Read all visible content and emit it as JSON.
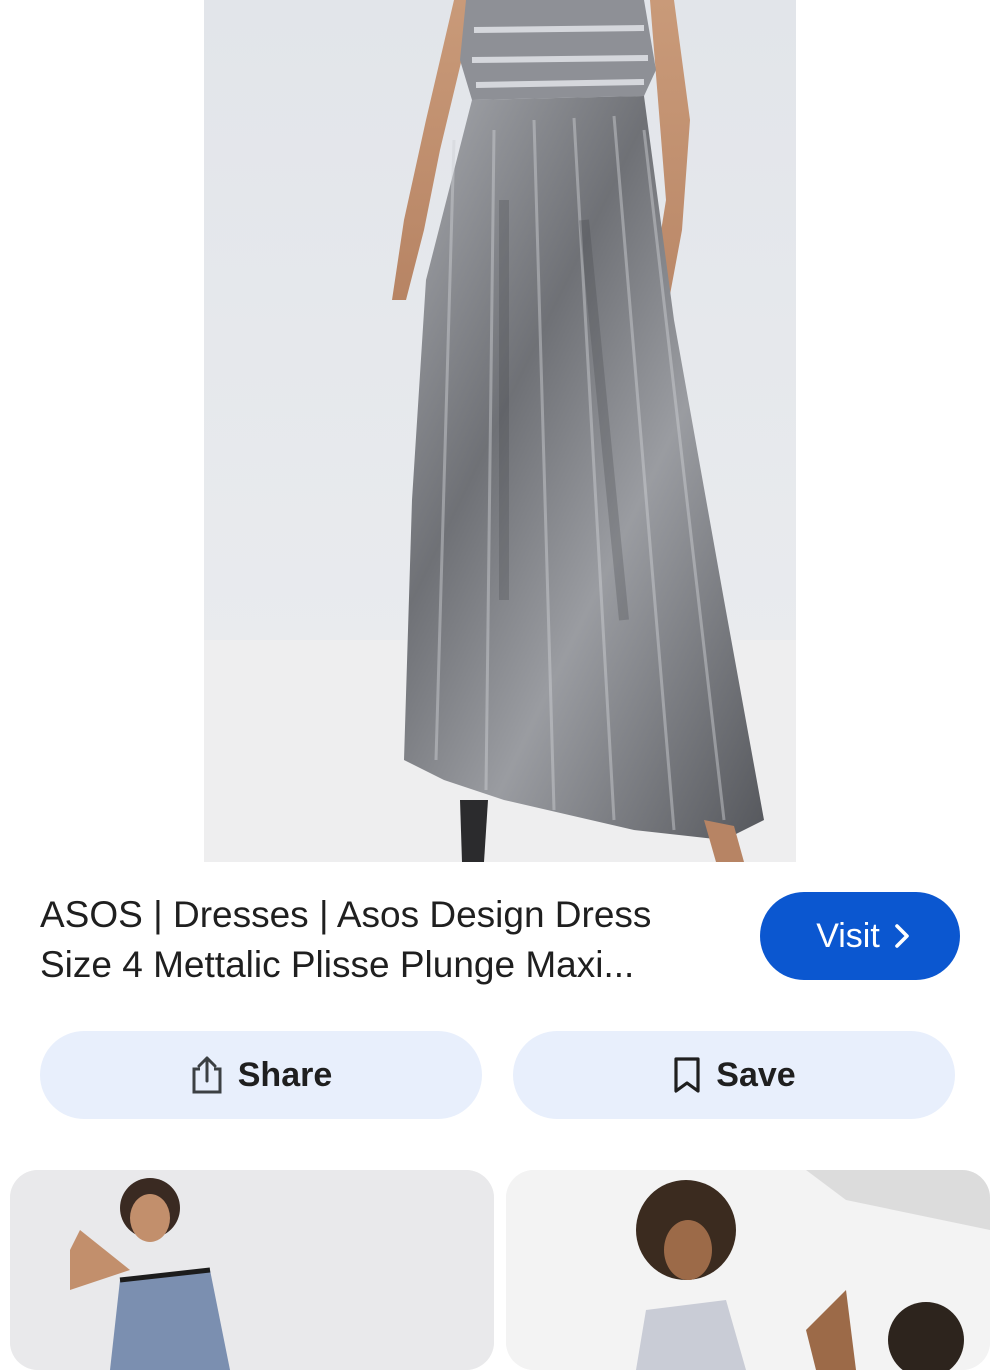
{
  "result": {
    "title": "ASOS | Dresses | Asos Design Dress Size 4 Mettalic Plisse Plunge Maxi...",
    "visit_label": "Visit"
  },
  "actions": {
    "share_label": "Share",
    "save_label": "Save"
  },
  "icons": {
    "visit": "chevron-right-icon",
    "share": "share-icon",
    "save": "bookmark-icon"
  },
  "colors": {
    "accent": "#0b57d0",
    "pill_bg": "#e8effc"
  }
}
